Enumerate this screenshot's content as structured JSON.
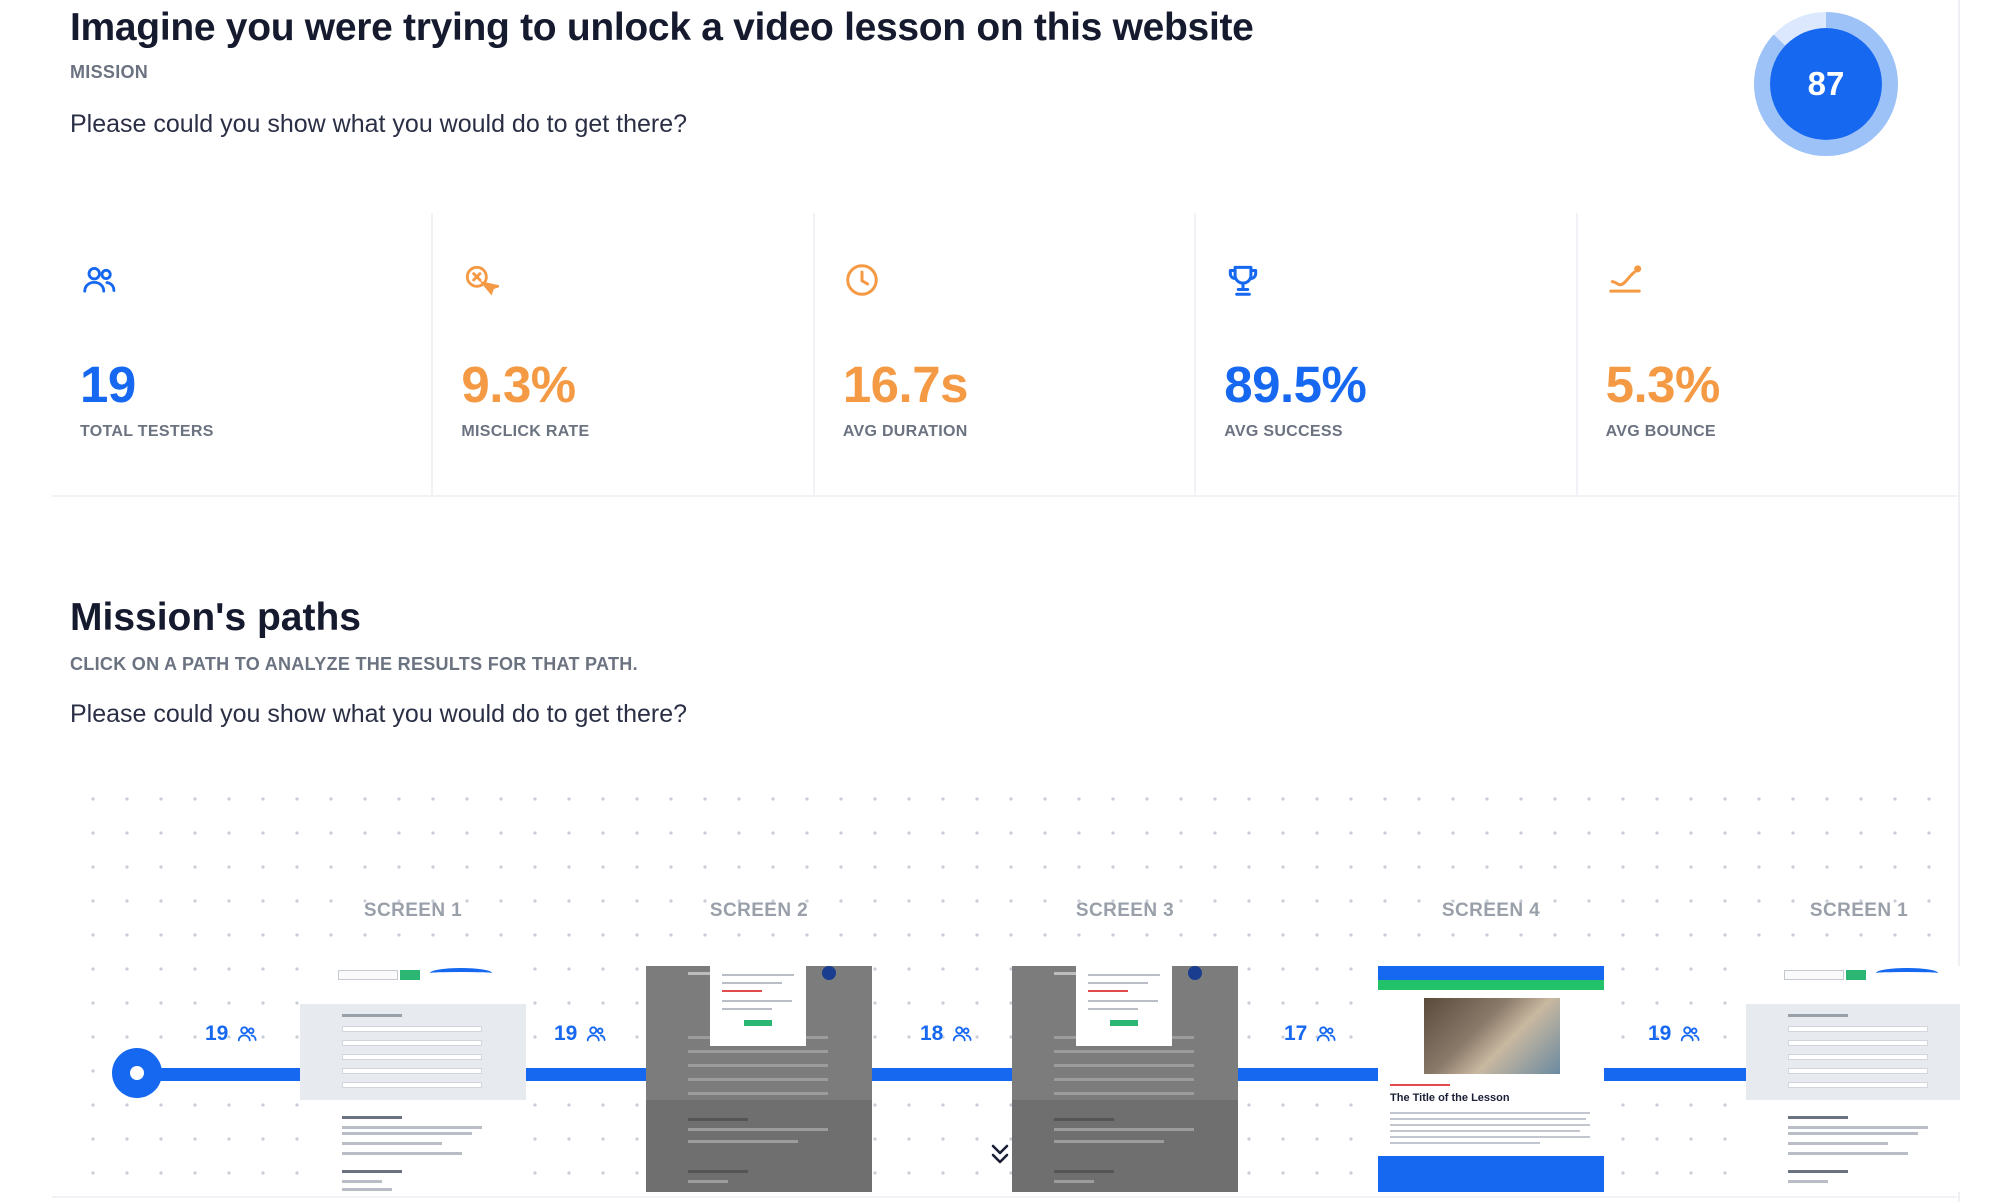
{
  "mission": {
    "title": "Imagine you were trying to unlock a video lesson on this website",
    "label": "MISSION",
    "question": "Please could you show what you would do to get there?",
    "score": "87",
    "score_fraction": 0.87
  },
  "stats": [
    {
      "icon": "users-icon",
      "value": "19",
      "label": "TOTAL TESTERS",
      "color": "#1668f0"
    },
    {
      "icon": "misclick-icon",
      "value": "9.3%",
      "label": "MISCLICK RATE",
      "color": "#f49a44"
    },
    {
      "icon": "clock-icon",
      "value": "16.7s",
      "label": "AVG DURATION",
      "color": "#f49a44"
    },
    {
      "icon": "trophy-icon",
      "value": "89.5%",
      "label": "AVG SUCCESS",
      "color": "#1668f0"
    },
    {
      "icon": "bounce-icon",
      "value": "5.3%",
      "label": "AVG BOUNCE",
      "color": "#f49a44"
    }
  ],
  "paths": {
    "title": "Mission's paths",
    "subtitle": "CLICK ON A PATH TO ANALYZE THE RESULTS FOR THAT PATH.",
    "question": "Please could you show what you would do to get there?",
    "steps": [
      {
        "screen": "SCREEN 1",
        "count": "19"
      },
      {
        "screen": "SCREEN 2",
        "count": "19"
      },
      {
        "screen": "SCREEN 3",
        "count": "18"
      },
      {
        "screen": "SCREEN 4",
        "count": "17"
      },
      {
        "screen": "SCREEN 1",
        "count": "19"
      }
    ],
    "lesson_thumb_title": "The Title of the Lesson"
  },
  "colors": {
    "accent": "#1668f0",
    "warning": "#f49a44",
    "ring_light": "#9cc2f8"
  }
}
